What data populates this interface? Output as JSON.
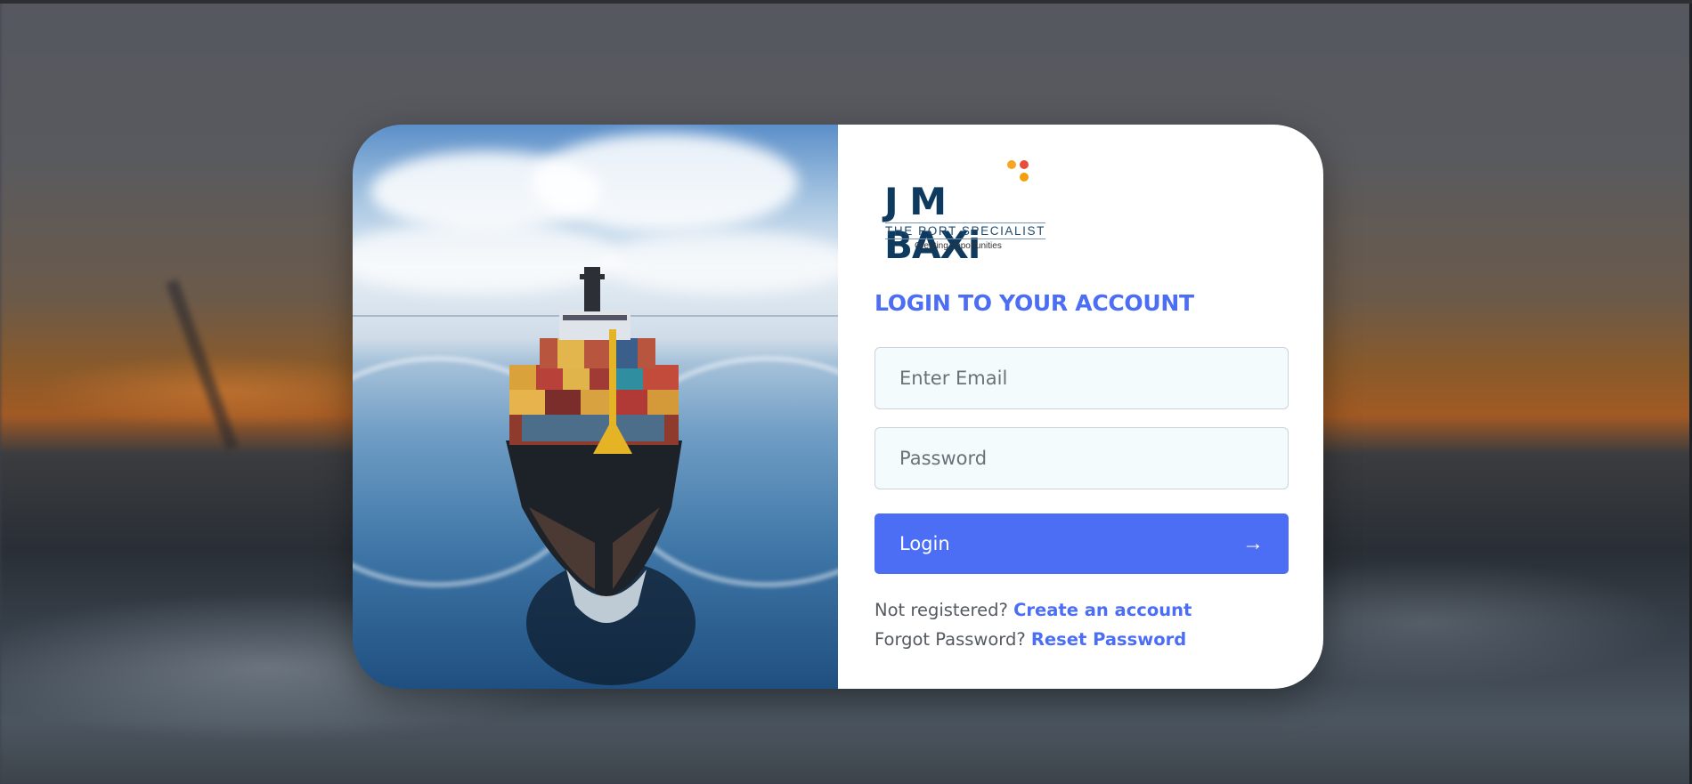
{
  "background": {
    "description_colors": {
      "accent": "#4c6ef5",
      "heading": "#4c6ef5",
      "input_bg": "#f3fbfd"
    }
  },
  "logo": {
    "main": "J M BAXi",
    "subtitle": "THE PORT SPECIALIST",
    "tagline": "Creating opportunities",
    "dot_colors": [
      "#f5a623",
      "#e84c3d",
      "#f59e0b"
    ]
  },
  "form": {
    "title": "LOGIN TO YOUR ACCOUNT",
    "email_placeholder": "Enter Email",
    "password_placeholder": "Password",
    "login_label": "Login",
    "login_arrow": "→",
    "register_prompt": "Not registered?",
    "register_link": "Create an account",
    "forgot_prompt": "Forgot Password?",
    "forgot_link": "Reset Password"
  },
  "icons": {
    "login_arrow": "arrow-right-icon"
  }
}
